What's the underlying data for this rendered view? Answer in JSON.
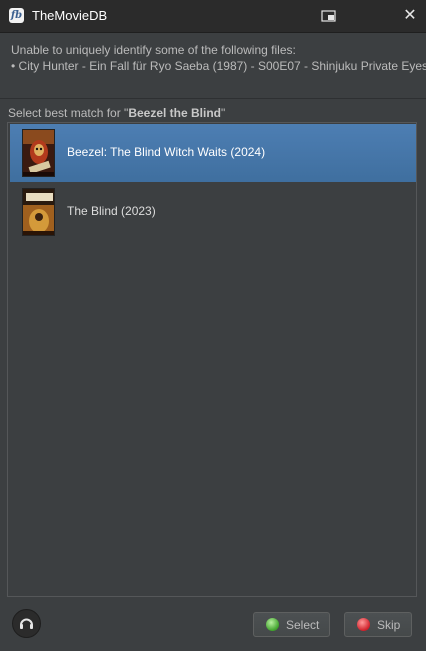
{
  "window": {
    "title": "TheMovieDB",
    "app_icon_text": "fb"
  },
  "message": {
    "line1": "Unable to uniquely identify some of the following files:",
    "line2": "• City Hunter - Ein Fall für Ryo Saeba (1987) - S00E07 - Shinjuku Private Eyes"
  },
  "prompt": {
    "prefix": "Select best match for \"",
    "query": "Beezel the Blind",
    "suffix": "\""
  },
  "results": [
    {
      "label": "Beezel: The Blind Witch Waits (2024)",
      "selected": true,
      "poster_icon": "beezel-poster-thumbnail"
    },
    {
      "label": "The Blind (2023)",
      "selected": false,
      "poster_icon": "the-blind-poster-thumbnail"
    }
  ],
  "buttons": {
    "select_label": "Select",
    "skip_label": "Skip"
  },
  "colors": {
    "background": "#3c3f41",
    "selection": "#4b6eaf",
    "titlebar": "#2b2b2b"
  }
}
